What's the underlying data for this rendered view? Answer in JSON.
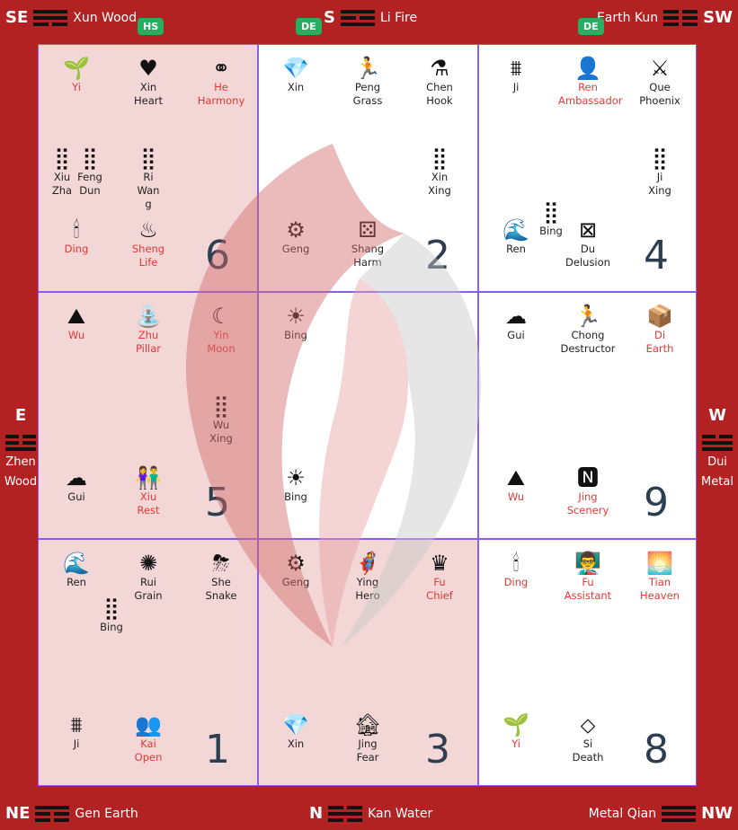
{
  "corners": {
    "se": {
      "dir": "SE",
      "label": "Xun Wood"
    },
    "s": {
      "dir": "S",
      "label": "Li Fire"
    },
    "sw": {
      "dir": "SW",
      "label": "Earth Kun"
    },
    "ne": {
      "dir": "NE",
      "label": "Gen Earth"
    },
    "n": {
      "dir": "N",
      "label": "Kan Water"
    },
    "nw": {
      "dir": "NW",
      "label": "Metal Qian"
    }
  },
  "sides": {
    "e": {
      "dir": "E",
      "line1": "Zhen",
      "line2": "Wood"
    },
    "w": {
      "dir": "W",
      "line1": "Dui",
      "line2": "Metal"
    }
  },
  "badges": {
    "hs": "HS",
    "de1": "DE",
    "de2": "DE"
  },
  "cells": {
    "c6": {
      "number": "6",
      "items": {
        "a": {
          "label": "Yi"
        },
        "b": {
          "label": "Xin",
          "sub": "Heart"
        },
        "c": {
          "label": "He",
          "sub": "Harmony"
        },
        "d": {
          "label": "Xiu",
          "sub": "Zha"
        },
        "e": {
          "label": "Feng",
          "sub": "Dun"
        },
        "f": {
          "label": "Ri",
          "sub": "Wan",
          "sub2": "g"
        },
        "g": {
          "label": "Ding"
        },
        "h": {
          "label": "Sheng",
          "sub": "Life"
        }
      }
    },
    "c2": {
      "number": "2",
      "items": {
        "a": {
          "label": "Xin"
        },
        "b": {
          "label": "Peng",
          "sub": "Grass"
        },
        "c": {
          "label": "Chen",
          "sub": "Hook"
        },
        "d": {
          "label": "Xin",
          "sub": "Xing"
        },
        "e": {
          "label": "Geng"
        },
        "f": {
          "label": "Shang",
          "sub": "Harm"
        }
      }
    },
    "c4": {
      "number": "4",
      "items": {
        "a": {
          "label": "Ji"
        },
        "b": {
          "label": "Ren",
          "sub": "Ambassador"
        },
        "c": {
          "label": "Que",
          "sub": "Phoenix"
        },
        "d": {
          "label": "Ji",
          "sub": "Xing"
        },
        "e": {
          "label": "Bing"
        },
        "f": {
          "label": "Ren"
        },
        "g": {
          "label": "Du",
          "sub": "Delusion"
        }
      }
    },
    "c5": {
      "number": "5",
      "items": {
        "a": {
          "label": "Wu"
        },
        "b": {
          "label": "Zhu",
          "sub": "Pillar"
        },
        "c": {
          "label": "Yin",
          "sub": "Moon"
        },
        "d": {
          "label": "Wu",
          "sub": "Xing"
        },
        "e": {
          "label": "Gui"
        },
        "f": {
          "label": "Xiu",
          "sub": "Rest"
        }
      }
    },
    "cc": {
      "number": "",
      "items": {
        "a": {
          "label": "Bing"
        },
        "b": {
          "label": "Bing"
        }
      }
    },
    "c9": {
      "number": "9",
      "items": {
        "a": {
          "label": "Gui"
        },
        "b": {
          "label": "Chong",
          "sub": "Destructor"
        },
        "c": {
          "label": "Di",
          "sub": "Earth"
        },
        "d": {
          "label": "Wu"
        },
        "e": {
          "label": "Jing",
          "sub": "Scenery"
        }
      }
    },
    "c1": {
      "number": "1",
      "items": {
        "a": {
          "label": "Ren"
        },
        "b": {
          "label": "Rui",
          "sub": "Grain"
        },
        "c": {
          "label": "She",
          "sub": "Snake"
        },
        "d": {
          "label": "Bing"
        },
        "e": {
          "label": "Ji"
        },
        "f": {
          "label": "Kai",
          "sub": "Open"
        }
      }
    },
    "c3": {
      "number": "3",
      "items": {
        "a": {
          "label": "Geng"
        },
        "b": {
          "label": "Ying",
          "sub": "Hero"
        },
        "c": {
          "label": "Fu",
          "sub": "Chief"
        },
        "d": {
          "label": "Xin"
        },
        "e": {
          "label": "Jing",
          "sub": "Fear"
        }
      }
    },
    "c8": {
      "number": "8",
      "items": {
        "a": {
          "label": "Ding"
        },
        "b": {
          "label": "Fu",
          "sub": "Assistant"
        },
        "c": {
          "label": "Tian",
          "sub": "Heaven"
        },
        "d": {
          "label": "Yi"
        },
        "e": {
          "label": "Si",
          "sub": "Death"
        }
      }
    }
  },
  "colors": {
    "background": "#b22222",
    "pink_cell": "#f3d6d6",
    "grid_line": "#8a5cf5",
    "red_text": "#e53935",
    "badge": "#27ae60"
  }
}
